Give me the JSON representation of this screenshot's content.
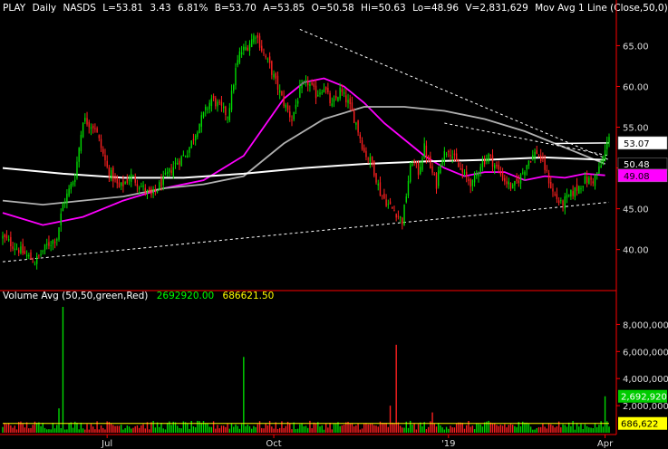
{
  "header": {
    "ticker": "PLAY",
    "period": "Daily",
    "exchange": "NASDS",
    "last": "L=53.81",
    "change": "3.43",
    "pct": "6.81%",
    "bid": "B=53.70",
    "ask": "A=53.85",
    "open": "O=50.58",
    "high": "Hi=50.63",
    "low": "Lo=48.96",
    "volume": "V=2,831,629",
    "ma_label": "Mov Avg 1 Line (Close,50,0)"
  },
  "volume_header": {
    "label": "Volume Avg (50,50,green,Red)",
    "v1": "2692920.00",
    "v2": "686621.50"
  },
  "price_tags": [
    {
      "text": "53.07",
      "value": 53.07,
      "bg": "#ffffff",
      "fg": "#000000"
    },
    {
      "text": "50.48",
      "value": 50.48,
      "bg": "#000000",
      "fg": "#ffffff"
    },
    {
      "text": "49.08",
      "value": 49.08,
      "bg": "#ff00ff",
      "fg": "#000000"
    }
  ],
  "volume_tags": [
    {
      "text": "2,692,920",
      "value": 2692920,
      "bg": "#00cc00",
      "fg": "#ffffff"
    },
    {
      "text": "686,622",
      "value": 686622,
      "bg": "#ffff00",
      "fg": "#000000"
    }
  ],
  "x_labels": [
    {
      "text": "Jul",
      "day": 52
    },
    {
      "text": "Oct",
      "day": 135
    },
    {
      "text": "'19",
      "day": 222
    },
    {
      "text": "Apr",
      "day": 300
    }
  ],
  "colors": {
    "up": "#00dd00",
    "down": "#ff2020",
    "ma_short": "#ff00ff",
    "ma_mid": "#b0b0b0",
    "ma_long": "#ffffff",
    "trend": "#ffffff",
    "vol_avg": "#ffff00",
    "axis": "#ff0000"
  },
  "chart_data": [
    {
      "type": "candlestick",
      "title": "PLAY Daily NASDS",
      "xlabel": "",
      "ylabel": "",
      "x_range_days": [
        0,
        302
      ],
      "ylim": [
        37,
        69
      ],
      "yticks": [
        40.0,
        45.0,
        50.0,
        55.0,
        60.0,
        65.0
      ],
      "price_path_days": [
        0,
        8,
        16,
        22,
        27,
        30,
        36,
        40,
        46,
        52,
        58,
        64,
        70,
        74,
        80,
        86,
        92,
        98,
        104,
        108,
        112,
        114,
        116,
        118,
        122,
        126,
        130,
        133,
        136,
        140,
        144,
        148,
        152,
        156,
        160,
        164,
        168,
        172,
        176,
        180,
        184,
        188,
        192,
        196,
        199,
        200,
        202,
        204,
        207,
        210,
        213,
        216,
        218,
        222,
        226,
        230,
        234,
        238,
        242,
        246,
        250,
        254,
        258,
        262,
        266,
        270,
        274,
        278,
        282,
        286,
        290,
        294,
        298,
        302
      ],
      "price_path_close": [
        41.5,
        40.0,
        38.5,
        40.5,
        41.5,
        45.5,
        49.0,
        56.0,
        55.0,
        50.0,
        47.5,
        49.0,
        47.5,
        46.5,
        48.5,
        50.5,
        52.0,
        55.5,
        58.5,
        57.5,
        56.5,
        59.0,
        62.0,
        64.0,
        65.0,
        66.5,
        64.0,
        62.5,
        60.5,
        58.0,
        56.0,
        59.5,
        60.5,
        59.0,
        60.0,
        57.5,
        59.5,
        58.0,
        55.5,
        52.0,
        50.5,
        47.0,
        45.5,
        44.5,
        43.5,
        45.0,
        48.5,
        51.0,
        49.5,
        52.5,
        50.0,
        48.0,
        51.0,
        52.5,
        50.5,
        49.0,
        48.0,
        50.5,
        51.5,
        50.0,
        48.5,
        47.5,
        49.0,
        51.0,
        52.0,
        50.0,
        47.0,
        45.5,
        46.5,
        47.5,
        48.5,
        48.5,
        50.3,
        53.8
      ],
      "last": 53.81,
      "moving_averages": [
        {
          "name": "Mov Avg 1 Line (Close,50,0)",
          "color": "#ff00ff",
          "days": [
            0,
            20,
            40,
            60,
            80,
            100,
            120,
            140,
            150,
            160,
            170,
            180,
            190,
            200,
            210,
            220,
            230,
            240,
            250,
            260,
            270,
            280,
            290,
            300
          ],
          "values": [
            44.5,
            43.0,
            44.0,
            46.0,
            47.5,
            48.5,
            51.5,
            58.5,
            60.5,
            61.0,
            60.0,
            58.0,
            55.5,
            53.5,
            51.5,
            50.0,
            49.0,
            49.5,
            49.5,
            48.5,
            49.0,
            48.8,
            49.3,
            49.1
          ]
        },
        {
          "name": "",
          "color": "#b0b0b0",
          "days": [
            0,
            20,
            40,
            60,
            80,
            100,
            120,
            140,
            160,
            180,
            200,
            220,
            240,
            260,
            280,
            300
          ],
          "values": [
            46.0,
            45.5,
            46.0,
            46.5,
            47.5,
            48.0,
            49.0,
            53.0,
            56.0,
            57.5,
            57.5,
            57.0,
            56.0,
            54.5,
            52.5,
            50.5
          ]
        },
        {
          "name": "",
          "color": "#ffffff",
          "days": [
            0,
            30,
            60,
            90,
            120,
            150,
            180,
            210,
            240,
            270,
            300
          ],
          "values": [
            50.0,
            49.3,
            48.8,
            48.8,
            49.3,
            50.0,
            50.5,
            50.8,
            51.0,
            51.3,
            51.0
          ]
        }
      ],
      "trend_lines": [
        {
          "style": "dashed",
          "from": [
            0,
            38.5
          ],
          "to": [
            302,
            45.8
          ]
        },
        {
          "style": "dashed",
          "from": [
            148,
            67.0
          ],
          "to": [
            302,
            51.0
          ]
        },
        {
          "style": "dashed",
          "from": [
            220,
            55.5
          ],
          "to": [
            302,
            51.5
          ]
        },
        {
          "style": "solid",
          "from": [
            275,
            53.0
          ],
          "to": [
            302,
            53.07
          ]
        }
      ]
    },
    {
      "type": "bar",
      "title": "Volume Avg (50,50,green,Red)",
      "xlabel": "",
      "ylabel": "",
      "ylim": [
        0,
        9500000
      ],
      "yticks": [
        2000000,
        4000000,
        6000000,
        8000000
      ],
      "ytick_labels": [
        "2,000,000",
        "4,000,000",
        "6,000,000",
        "8,000,000"
      ],
      "avg_volume": 686622,
      "last_volume": 2692920,
      "spikes": [
        {
          "day": 30,
          "value": 9300000
        },
        {
          "day": 28,
          "value": 1800000
        },
        {
          "day": 120,
          "value": 5600000
        },
        {
          "day": 196,
          "value": 6500000
        },
        {
          "day": 193,
          "value": 2000000
        },
        {
          "day": 214,
          "value": 1500000
        },
        {
          "day": 300,
          "value": 2692920
        }
      ],
      "baseline_volume": 550000
    }
  ]
}
